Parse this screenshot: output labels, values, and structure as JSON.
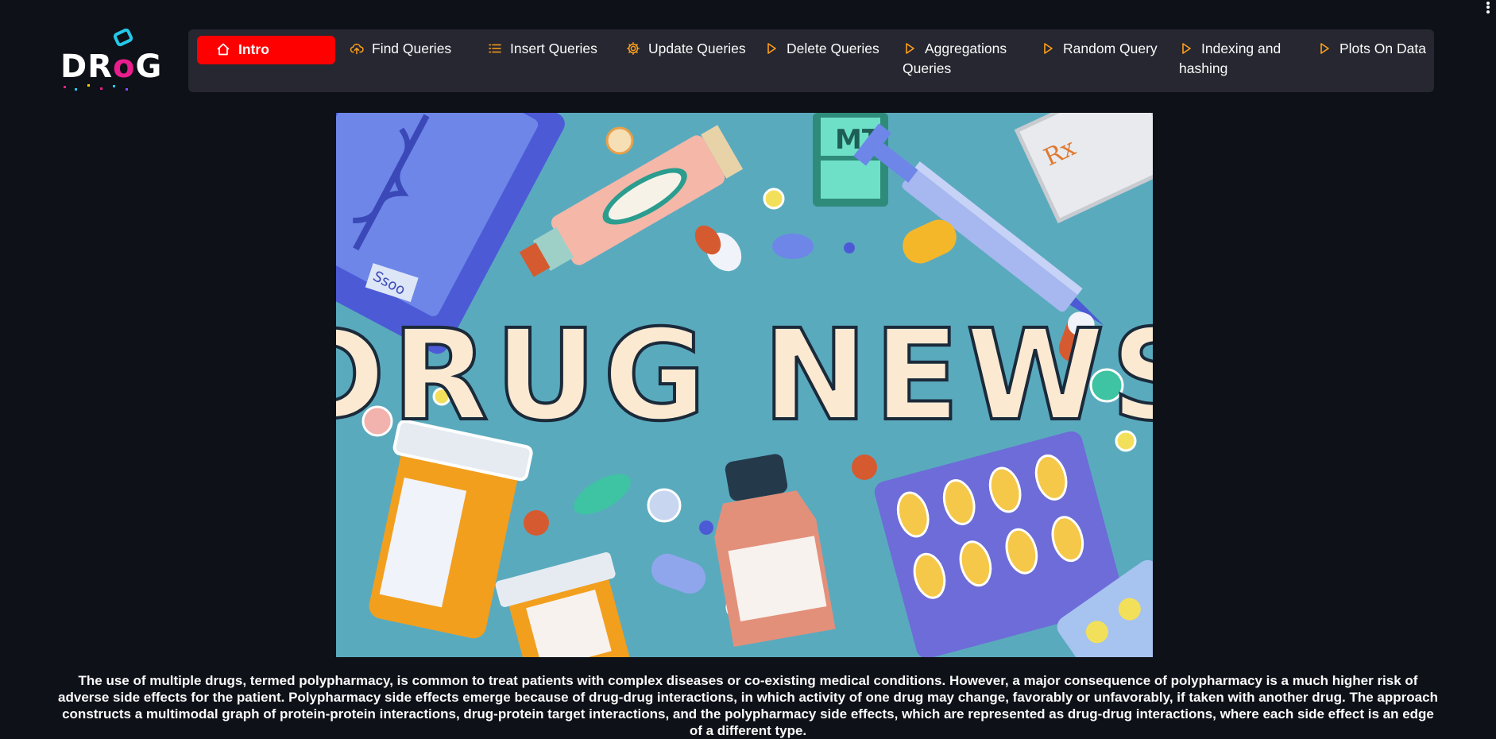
{
  "logo": {
    "text_left": "DR",
    "text_o": "o",
    "text_right": "G"
  },
  "nav": {
    "items": [
      {
        "label": "Intro",
        "icon": "house-icon"
      },
      {
        "label": "Find Queries",
        "icon": "cloud-upload-icon"
      },
      {
        "label": "Insert Queries",
        "icon": "list-icon"
      },
      {
        "label": "Update Queries",
        "icon": "gear-icon"
      },
      {
        "label": "Delete Queries",
        "icon": "play-triangle-icon"
      },
      {
        "label": "Aggregations Queries",
        "icon": "play-triangle-icon"
      },
      {
        "label": "Random Query",
        "icon": "play-triangle-icon"
      },
      {
        "label": "Indexing and hashing",
        "icon": "play-triangle-icon"
      },
      {
        "label": "Plots On Data",
        "icon": "play-triangle-icon"
      }
    ],
    "active_index": 0
  },
  "hero": {
    "headline": "DRUG NEWS",
    "rx_label": "Rx",
    "box_label": "MT",
    "vial_label": "Ssoo"
  },
  "caption": "The use of multiple drugs, termed polypharmacy, is common to treat patients with complex diseases or co-existing medical conditions. However, a major consequence of polypharmacy is a much higher risk of adverse side effects for the patient. Polypharmacy side effects emerge because of drug-drug interactions, in which activity of one drug may change, favorably or unfavorably, if taken with another drug. The approach constructs a multimodal graph of protein-protein interactions, drug-protein target interactions, and the polypharmacy side effects, which are represented as drug-drug interactions, where each side effect is an edge of a different type.",
  "colors": {
    "background": "#0e1117",
    "navbar": "#262730",
    "active": "#ff0000",
    "icon_orange": "#ff9f1c",
    "hero_bg": "#5aaabe"
  }
}
